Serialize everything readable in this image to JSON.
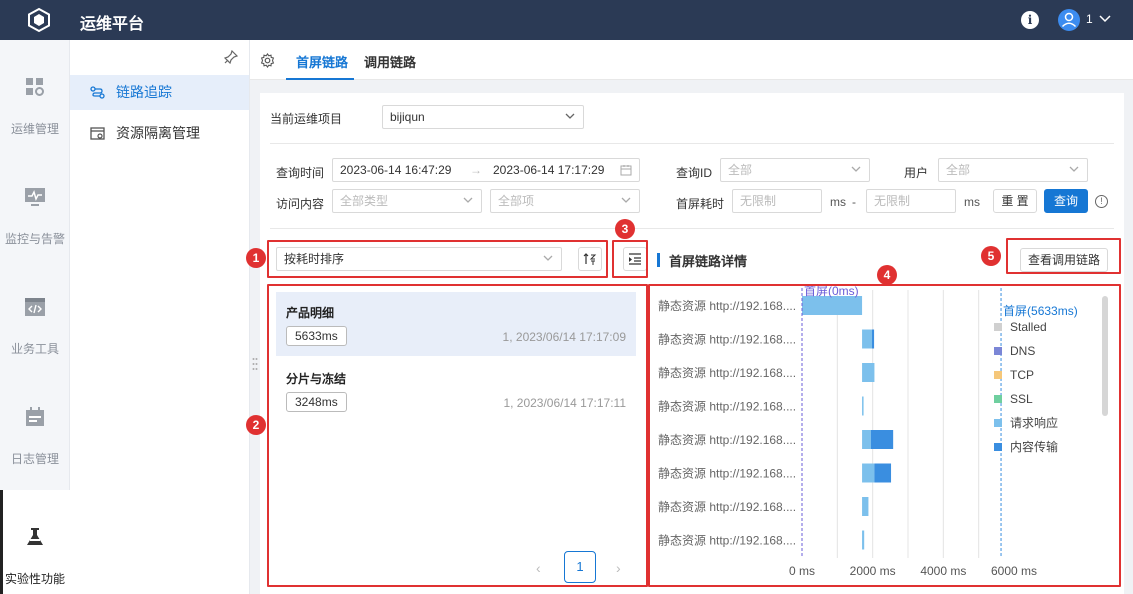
{
  "app": {
    "title": "运维平台",
    "user_count": "1"
  },
  "sidebar": {
    "items": [
      {
        "label": "运维管理",
        "icon": "dashboard-icon"
      },
      {
        "label": "监控与告警",
        "icon": "monitor-icon"
      },
      {
        "label": "业务工具",
        "icon": "code-window-icon"
      },
      {
        "label": "日志管理",
        "icon": "calendar-icon"
      },
      {
        "label": "实验性功能",
        "icon": "flask-icon"
      }
    ]
  },
  "subnav": {
    "items": [
      {
        "label": "链路追踪",
        "icon": "link-trace-icon"
      },
      {
        "label": "资源隔离管理",
        "icon": "resource-icon"
      }
    ]
  },
  "tabs": [
    {
      "label": "首屏链路"
    },
    {
      "label": "调用链路"
    }
  ],
  "filters": {
    "project_label": "当前运维项目",
    "project_value": "bijiqun",
    "query_time_label": "查询时间",
    "time_start": "2023-06-14 16:47:29",
    "time_end": "2023-06-14 17:17:29",
    "query_id_label": "查询ID",
    "query_id_placeholder": "全部",
    "user_label": "用户",
    "user_placeholder": "全部",
    "content_label": "访问内容",
    "content_type_placeholder": "全部类型",
    "content_item_placeholder": "全部项",
    "duration_label": "首屏耗时",
    "duration_min_placeholder": "无限制",
    "duration_max_placeholder": "无限制",
    "unit_ms": "ms",
    "range_dash": "-",
    "reset_label": "重 置",
    "query_label": "查询"
  },
  "list": {
    "sort_value": "按耗时排序",
    "items": [
      {
        "title": "产品明细",
        "duration": "5633ms",
        "meta": "1, 2023/06/14 17:17:09"
      },
      {
        "title": "分片与冻结",
        "duration": "3248ms",
        "meta": "1, 2023/06/14 17:17:11"
      }
    ],
    "page": "1"
  },
  "detail": {
    "title": "首屏链路详情",
    "view_call_chain_label": "查看调用链路",
    "resource_label": "静态资源 http://192.168....",
    "first_screen_start_label": "首屏(0ms)",
    "first_screen_end_label": "首屏(5633ms)"
  },
  "markers": [
    "1",
    "2",
    "3",
    "4",
    "5"
  ],
  "chart_data": {
    "type": "bar",
    "orientation": "horizontal-stacked-waterfall",
    "categories": [
      "静态资源 http://192.168....",
      "静态资源 http://192.168....",
      "静态资源 http://192.168....",
      "静态资源 http://192.168....",
      "静态资源 http://192.168....",
      "静态资源 http://192.168....",
      "静态资源 http://192.168....",
      "静态资源 http://192.168...."
    ],
    "xlim": [
      0,
      6000
    ],
    "x_ticks": [
      "0 ms",
      "2000 ms",
      "4000 ms",
      "6000 ms"
    ],
    "x_tick_values": [
      0,
      2000,
      4000,
      6000
    ],
    "markers": [
      {
        "value": 0,
        "label": "首屏(0ms)"
      },
      {
        "value": 5633,
        "label": "首屏(5633ms)"
      }
    ],
    "legend": [
      {
        "name": "Stalled",
        "color": "#d0d0d0"
      },
      {
        "name": "DNS",
        "color": "#7b86d6"
      },
      {
        "name": "TCP",
        "color": "#f5c77a"
      },
      {
        "name": "SSL",
        "color": "#6fcf9f"
      },
      {
        "name": "请求响应",
        "color": "#7cc0ec"
      },
      {
        "name": "内容传输",
        "color": "#3a8ee0"
      }
    ],
    "rows": [
      {
        "start": 0,
        "segments": [
          {
            "phase": "请求响应",
            "duration": 1700
          }
        ]
      },
      {
        "start": 1700,
        "segments": [
          {
            "phase": "请求响应",
            "duration": 280
          },
          {
            "phase": "内容传输",
            "duration": 60
          }
        ]
      },
      {
        "start": 1700,
        "segments": [
          {
            "phase": "请求响应",
            "duration": 350
          }
        ]
      },
      {
        "start": 1700,
        "segments": [
          {
            "phase": "请求响应",
            "duration": 20
          }
        ]
      },
      {
        "start": 1700,
        "segments": [
          {
            "phase": "请求响应",
            "duration": 250
          },
          {
            "phase": "内容传输",
            "duration": 630
          }
        ]
      },
      {
        "start": 1700,
        "segments": [
          {
            "phase": "请求响应",
            "duration": 350
          },
          {
            "phase": "内容传输",
            "duration": 470
          }
        ]
      },
      {
        "start": 1700,
        "segments": [
          {
            "phase": "请求响应",
            "duration": 180
          }
        ]
      },
      {
        "start": 1700,
        "segments": [
          {
            "phase": "请求响应",
            "duration": 60
          }
        ]
      }
    ],
    "grid": true,
    "legend_position": "right"
  }
}
